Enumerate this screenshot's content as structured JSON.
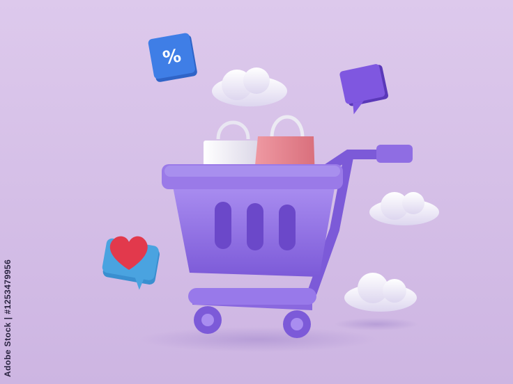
{
  "scene": {
    "description_visible": false,
    "discount_badge": {
      "symbol": "%"
    },
    "stock_id": "Adobe Stock | #1253479956",
    "palette": {
      "background_top": "#ddc9ec",
      "background_bottom": "#cdb5e2",
      "cart": "#8f6de3",
      "cart_dark": "#6b48c9",
      "cart_light": "#a98df0",
      "bag_white": "#f2f0f7",
      "bag_pink": "#e8848f",
      "badge_blue": "#3f7ee6",
      "heart_red": "#e2394c",
      "bubble_teal": "#4aa3e0",
      "chat_violet": "#7f57e0",
      "cloud": "#f5f3fb"
    },
    "icons": [
      "shopping-cart-icon",
      "shopping-bag-icon",
      "percent-icon",
      "heart-icon",
      "chat-bubble-icon",
      "cloud-icon"
    ]
  }
}
